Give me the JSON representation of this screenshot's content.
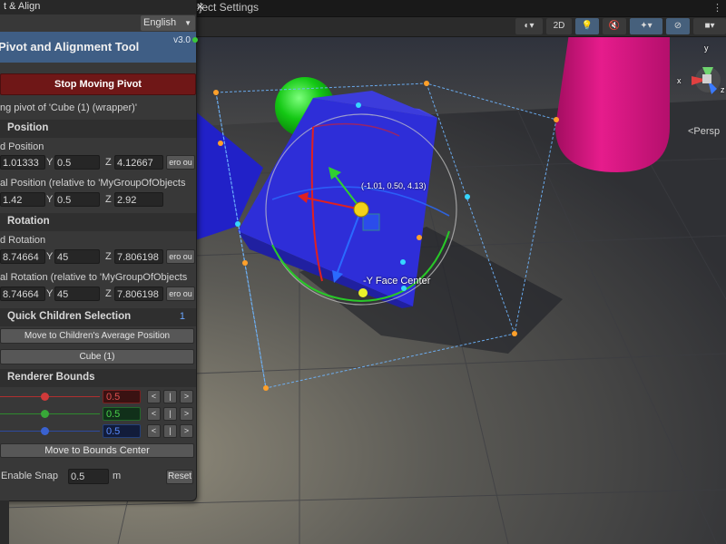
{
  "window": {
    "panel_tab_title": "t & Align",
    "second_tab_title": "oject Settings"
  },
  "scene_toolbar": {
    "mode_2d_label": "2D",
    "persp_label": "<Persp",
    "gizmo_axis_y": "y",
    "gizmo_axis_x": "x",
    "gizmo_axis_z": "z"
  },
  "viewport": {
    "coord_readout": "(-1.01, 0.50, 4.13)",
    "face_label": "-Y Face Center"
  },
  "panel": {
    "language_value": "English",
    "title": "Pivot and Alignment Tool",
    "version": "v3.0",
    "stop_button_label": "Stop Moving Pivot",
    "editing_text": "ng pivot of 'Cube (1) (wrapper)'",
    "position": {
      "section_label": "Position",
      "world_label": "d Position",
      "world_x": "1.01333",
      "world_y": "0.5",
      "world_z": "4.12667",
      "world_zero_label": "ero ou",
      "local_label": "al Position (relative to 'MyGroupOfObjects",
      "local_x": "1.42",
      "local_y": "0.5",
      "local_z": "2.92"
    },
    "rotation": {
      "section_label": "Rotation",
      "world_label": "d Rotation",
      "world_x": "8.74664",
      "world_y": "45",
      "world_z": "7.806198",
      "world_zero_label": "ero ou",
      "local_label": "al Rotation (relative to 'MyGroupOfObjects",
      "local_x": "8.74664",
      "local_y": "45",
      "local_z": "7.806198",
      "local_zero_label": "ero ou"
    },
    "axis_labels": {
      "x": "X",
      "y": "Y",
      "z": "Z"
    },
    "quick_children": {
      "section_label": "Quick Children Selection",
      "count": "1",
      "move_avg_label": "Move to Children's Average Position",
      "child_label": "Cube (1)"
    },
    "renderer_bounds": {
      "section_label": "Renderer Bounds",
      "x_value": "0.5",
      "y_value": "0.5",
      "z_value": "0.5",
      "btn_left": "<",
      "btn_mid": "|",
      "btn_right": ">",
      "move_center_label": "Move to Bounds Center"
    },
    "snap": {
      "label": "Enable Snap",
      "value": "0.5",
      "unit": "m",
      "reset_label": "Reset"
    }
  },
  "colors": {
    "header_blue": "#3f5e85",
    "stop_red": "#6f1717",
    "cube_blue": "#2f2fd6",
    "capsule_magenta": "#d1157e",
    "sphere_green": "#14c814",
    "bounds_line": "#6fb6ff",
    "handle_orange": "#ffa02a"
  }
}
